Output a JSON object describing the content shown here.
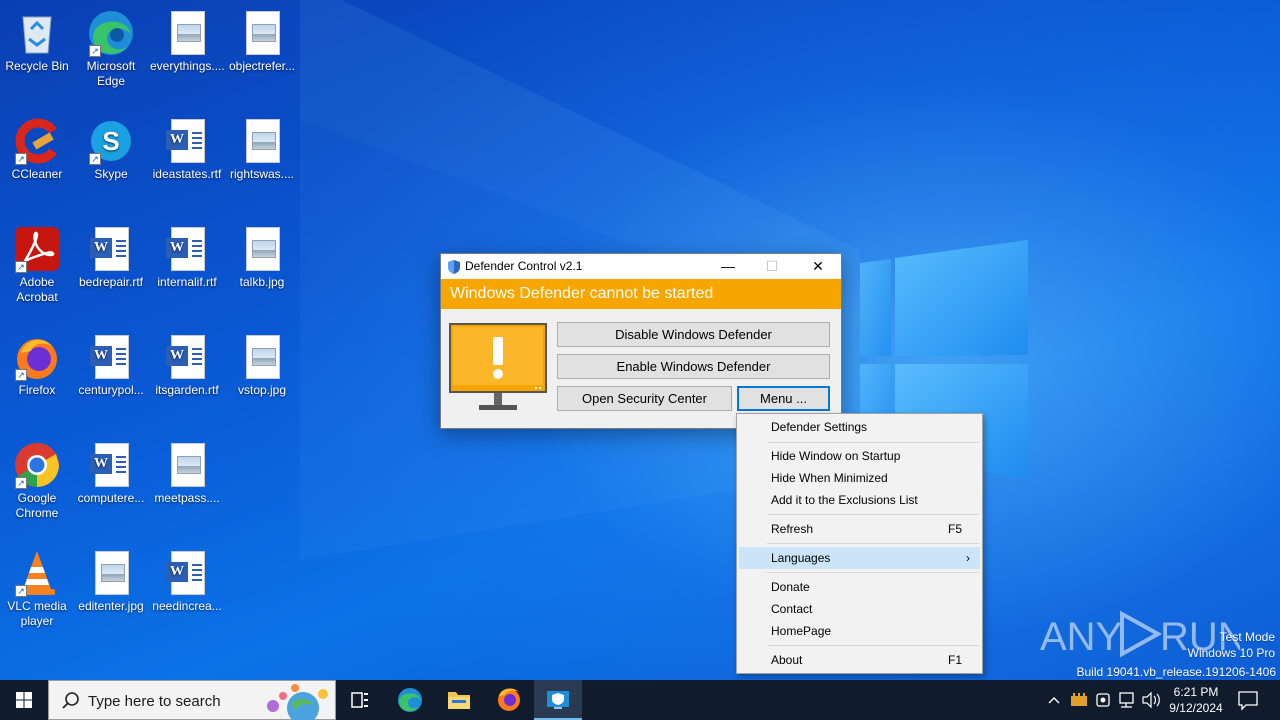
{
  "desktop": {
    "icons": [
      {
        "label": "Recycle Bin"
      },
      {
        "label": "Microsoft Edge"
      },
      {
        "label": "everythings...."
      },
      {
        "label": "objectrefer..."
      },
      {
        "label": "CCleaner"
      },
      {
        "label": "Skype"
      },
      {
        "label": "ideastates.rtf"
      },
      {
        "label": "rightswas...."
      },
      {
        "label": "Adobe Acrobat"
      },
      {
        "label": "bedrepair.rtf"
      },
      {
        "label": "internalif.rtf"
      },
      {
        "label": "talkb.jpg"
      },
      {
        "label": "Firefox"
      },
      {
        "label": "centurypol..."
      },
      {
        "label": "itsgarden.rtf"
      },
      {
        "label": "vstop.jpg"
      },
      {
        "label": "Google Chrome"
      },
      {
        "label": "computere..."
      },
      {
        "label": "meetpass...."
      },
      {
        "label": "VLC media player"
      },
      {
        "label": "editenter.jpg"
      },
      {
        "label": "needincrea..."
      }
    ]
  },
  "dialog": {
    "title": "Defender Control v2.1",
    "banner": "Windows Defender cannot be started",
    "buttons": {
      "disable": "Disable Windows Defender",
      "enable": "Enable Windows Defender",
      "security_center": "Open Security Center",
      "menu": "Menu ..."
    },
    "controls": {
      "minimize": "—",
      "maximize": "☐",
      "close": "✕"
    }
  },
  "menu": {
    "items": [
      {
        "label": "Defender Settings",
        "shortcut": ""
      },
      {
        "label": "Hide Window on Startup",
        "shortcut": ""
      },
      {
        "label": "Hide When Minimized",
        "shortcut": ""
      },
      {
        "label": "Add it to the Exclusions List",
        "shortcut": ""
      },
      {
        "label": "Refresh",
        "shortcut": "F5"
      },
      {
        "label": "Languages",
        "shortcut": "",
        "submenu": true,
        "highlighted": true
      },
      {
        "label": "Donate",
        "shortcut": ""
      },
      {
        "label": "Contact",
        "shortcut": ""
      },
      {
        "label": "HomePage",
        "shortcut": ""
      },
      {
        "label": "About",
        "shortcut": "F1"
      }
    ],
    "submenu_arrow": "›"
  },
  "watermark": {
    "brand": "ANY RUN",
    "line1": "Test Mode",
    "line2": "Windows 10 Pro",
    "line3": "Build 19041.vb_release.191206-1406"
  },
  "taskbar": {
    "search_placeholder": "Type here to search",
    "clock_time": "6:21 PM",
    "clock_date": "9/12/2024"
  },
  "colors": {
    "banner": "#f7a600",
    "taskbar": "#101c2c",
    "menu_highlight": "#cce4f7",
    "focus_border": "#0078d7"
  }
}
